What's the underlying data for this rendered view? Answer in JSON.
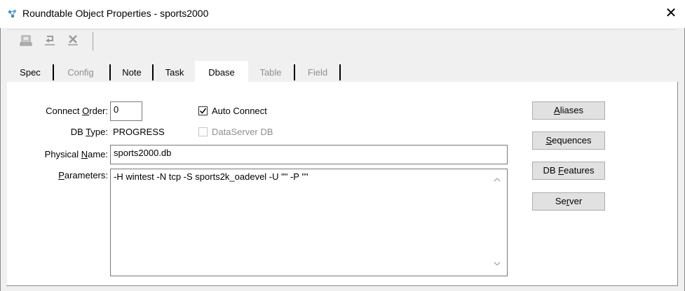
{
  "window": {
    "title": "Roundtable Object Properties - sports2000",
    "app_icon": "roundtable-icon",
    "close_glyph": "✕"
  },
  "toolbar": {
    "buttons": [
      {
        "name": "save-icon",
        "enabled": false
      },
      {
        "name": "undo-icon",
        "enabled": false
      },
      {
        "name": "delete-icon",
        "enabled": false
      }
    ]
  },
  "tabs": [
    {
      "label": "Spec",
      "enabled": true,
      "active": false
    },
    {
      "label": "Config",
      "enabled": false,
      "active": false
    },
    {
      "label": "Note",
      "enabled": true,
      "active": false
    },
    {
      "label": "Task",
      "enabled": true,
      "active": false
    },
    {
      "label": "Dbase",
      "enabled": true,
      "active": true
    },
    {
      "label": "Table",
      "enabled": false,
      "active": false
    },
    {
      "label": "Field",
      "enabled": false,
      "active": false
    }
  ],
  "form": {
    "connect_order": {
      "label_pre": "Connect ",
      "label_ul": "O",
      "label_post": "rder:",
      "value": "0"
    },
    "auto_connect": {
      "label": "Auto Connect",
      "checked": true
    },
    "db_type": {
      "label_pre": "DB ",
      "label_ul": "T",
      "label_post": "ype:",
      "value": "PROGRESS"
    },
    "dataserver_db": {
      "label": "DataServer DB",
      "checked": false,
      "enabled": false
    },
    "physical_name": {
      "label_pre": "Physical ",
      "label_ul": "N",
      "label_post": "ame:",
      "value": "sports2000.db"
    },
    "parameters": {
      "label_pre": "",
      "label_ul": "P",
      "label_post": "arameters:",
      "value": "-H wintest -N tcp -S sports2k_oadevel -U \"\" -P \"\""
    }
  },
  "side_buttons": [
    {
      "pre": "",
      "ul": "A",
      "post": "liases"
    },
    {
      "pre": "",
      "ul": "S",
      "post": "equences"
    },
    {
      "pre": "DB ",
      "ul": "F",
      "post": "eatures"
    },
    {
      "pre": "Se",
      "ul": "r",
      "post": "ver"
    }
  ],
  "colors": {
    "disabled_text": "#8f8f8f",
    "dialog_bg": "#f0f0f0",
    "button_bg": "#e1e1e1"
  }
}
